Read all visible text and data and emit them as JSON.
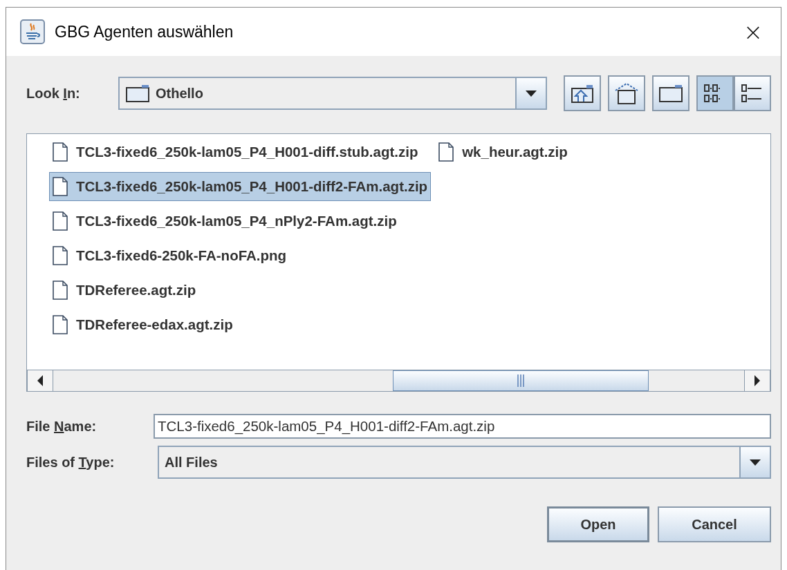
{
  "window": {
    "title": "GBG Agenten auswählen",
    "close": "×"
  },
  "look_in": {
    "label": {
      "before": "Look ",
      "mnemonic": "I",
      "after": "n:"
    },
    "value": "Othello"
  },
  "toolbar": [
    {
      "kind": "up",
      "selected": false
    },
    {
      "kind": "home",
      "selected": false
    },
    {
      "kind": "new-folder",
      "selected": false
    },
    {
      "kind": "list",
      "selected": true
    },
    {
      "kind": "details",
      "selected": false
    }
  ],
  "files": [
    {
      "name": "TCL3-fixed6_250k-lam05_P4_H001-diff.stub.agt.zip",
      "selected": false
    },
    {
      "name": "TCL3-fixed6_250k-lam05_P4_H001-diff2-FAm.agt.zip",
      "selected": true
    },
    {
      "name": "TCL3-fixed6_250k-lam05_P4_nPly2-FAm.agt.zip",
      "selected": false
    },
    {
      "name": "TCL3-fixed6-250k-FA-noFA.png",
      "selected": false
    },
    {
      "name": "TDReferee.agt.zip",
      "selected": false
    },
    {
      "name": "TDReferee-edax.agt.zip",
      "selected": false
    },
    {
      "name": "wk_heur.agt.zip",
      "selected": false
    }
  ],
  "file_name": {
    "label": {
      "before": "File ",
      "mnemonic": "N",
      "after": "ame:"
    },
    "value": "TCL3-fixed6_250k-lam05_P4_H001-diff2-FAm.agt.zip"
  },
  "files_of_type": {
    "label": {
      "before": "Files of ",
      "mnemonic": "T",
      "after": "ype:"
    },
    "value": "All Files"
  },
  "buttons": [
    {
      "label": "Open",
      "default": true
    },
    {
      "label": "Cancel",
      "default": false
    }
  ]
}
